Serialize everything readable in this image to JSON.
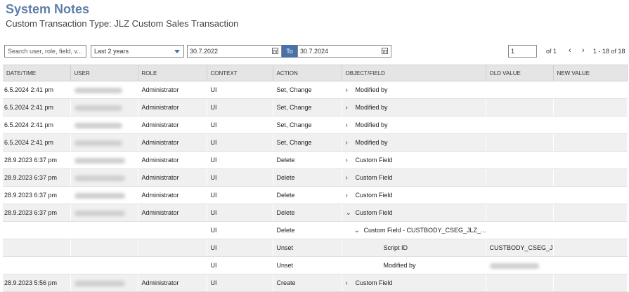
{
  "page": {
    "title": "System Notes",
    "subtitle": "Custom Transaction Type: JLZ Custom Sales Transaction"
  },
  "toolbar": {
    "search_placeholder": "Search user, role, field, v...",
    "range_value": "Last 2 years",
    "date_from": "30.7.2022",
    "to_label": "To",
    "date_to": "30.7.2024",
    "page_value": "1",
    "page_of": "of 1",
    "prev_icon": "‹",
    "next_icon": "›",
    "range_text": "1 - 18 of 18"
  },
  "table": {
    "columns": [
      "DATE/TIME",
      "USER",
      "ROLE",
      "CONTEXT",
      "ACTION",
      "OBJECT/FIELD",
      "OLD VALUE",
      "NEW VALUE"
    ],
    "rows": [
      {
        "date": "6.5.2024 2:41 pm",
        "role": "Administrator",
        "context": "UI",
        "action": "Set, Change",
        "chevron": "›",
        "object": "Modified by",
        "old": ""
      },
      {
        "date": "6.5.2024 2:41 pm",
        "role": "Administrator",
        "context": "UI",
        "action": "Set, Change",
        "chevron": "›",
        "object": "Modified by",
        "old": ""
      },
      {
        "date": "6.5.2024 2:41 pm",
        "role": "Administrator",
        "context": "UI",
        "action": "Set, Change",
        "chevron": "›",
        "object": "Modified by",
        "old": ""
      },
      {
        "date": "6.5.2024 2:41 pm",
        "role": "Administrator",
        "context": "UI",
        "action": "Set, Change",
        "chevron": "›",
        "object": "Modified by",
        "old": ""
      },
      {
        "date": "28.9.2023 6:37 pm",
        "role": "Administrator",
        "context": "UI",
        "action": "Delete",
        "chevron": "›",
        "object": "Custom Field",
        "old": ""
      },
      {
        "date": "28.9.2023 6:37 pm",
        "role": "Administrator",
        "context": "UI",
        "action": "Delete",
        "chevron": "›",
        "object": "Custom Field",
        "old": ""
      },
      {
        "date": "28.9.2023 6:37 pm",
        "role": "Administrator",
        "context": "UI",
        "action": "Delete",
        "chevron": "›",
        "object": "Custom Field",
        "old": ""
      },
      {
        "date": "28.9.2023 6:37 pm",
        "role": "Administrator",
        "context": "UI",
        "action": "Delete",
        "chevron": "⌄",
        "object": "Custom Field",
        "old": ""
      },
      {
        "date": "",
        "role": "",
        "context": "UI",
        "action": "Delete",
        "chevron": "⌄",
        "object": "Custom Field - CUSTBODY_CSEG_JLZ_...",
        "old": ""
      },
      {
        "date": "",
        "role": "",
        "context": "UI",
        "action": "Unset",
        "chevron": "",
        "object": "Script ID",
        "old": "CUSTBODY_CSEG_JL..."
      },
      {
        "date": "",
        "role": "",
        "context": "UI",
        "action": "Unset",
        "chevron": "",
        "object": "Modified by",
        "old": ""
      },
      {
        "date": "28.9.2023 5:56 pm",
        "role": "Administrator",
        "context": "UI",
        "action": "Create",
        "chevron": "›",
        "object": "Custom Field",
        "old": ""
      }
    ]
  },
  "colors": {
    "title": "#5d7fa6",
    "to_button": "#4a72a8",
    "header_bg": "#e5e5e5",
    "row_shade": "#f0f0f0"
  }
}
